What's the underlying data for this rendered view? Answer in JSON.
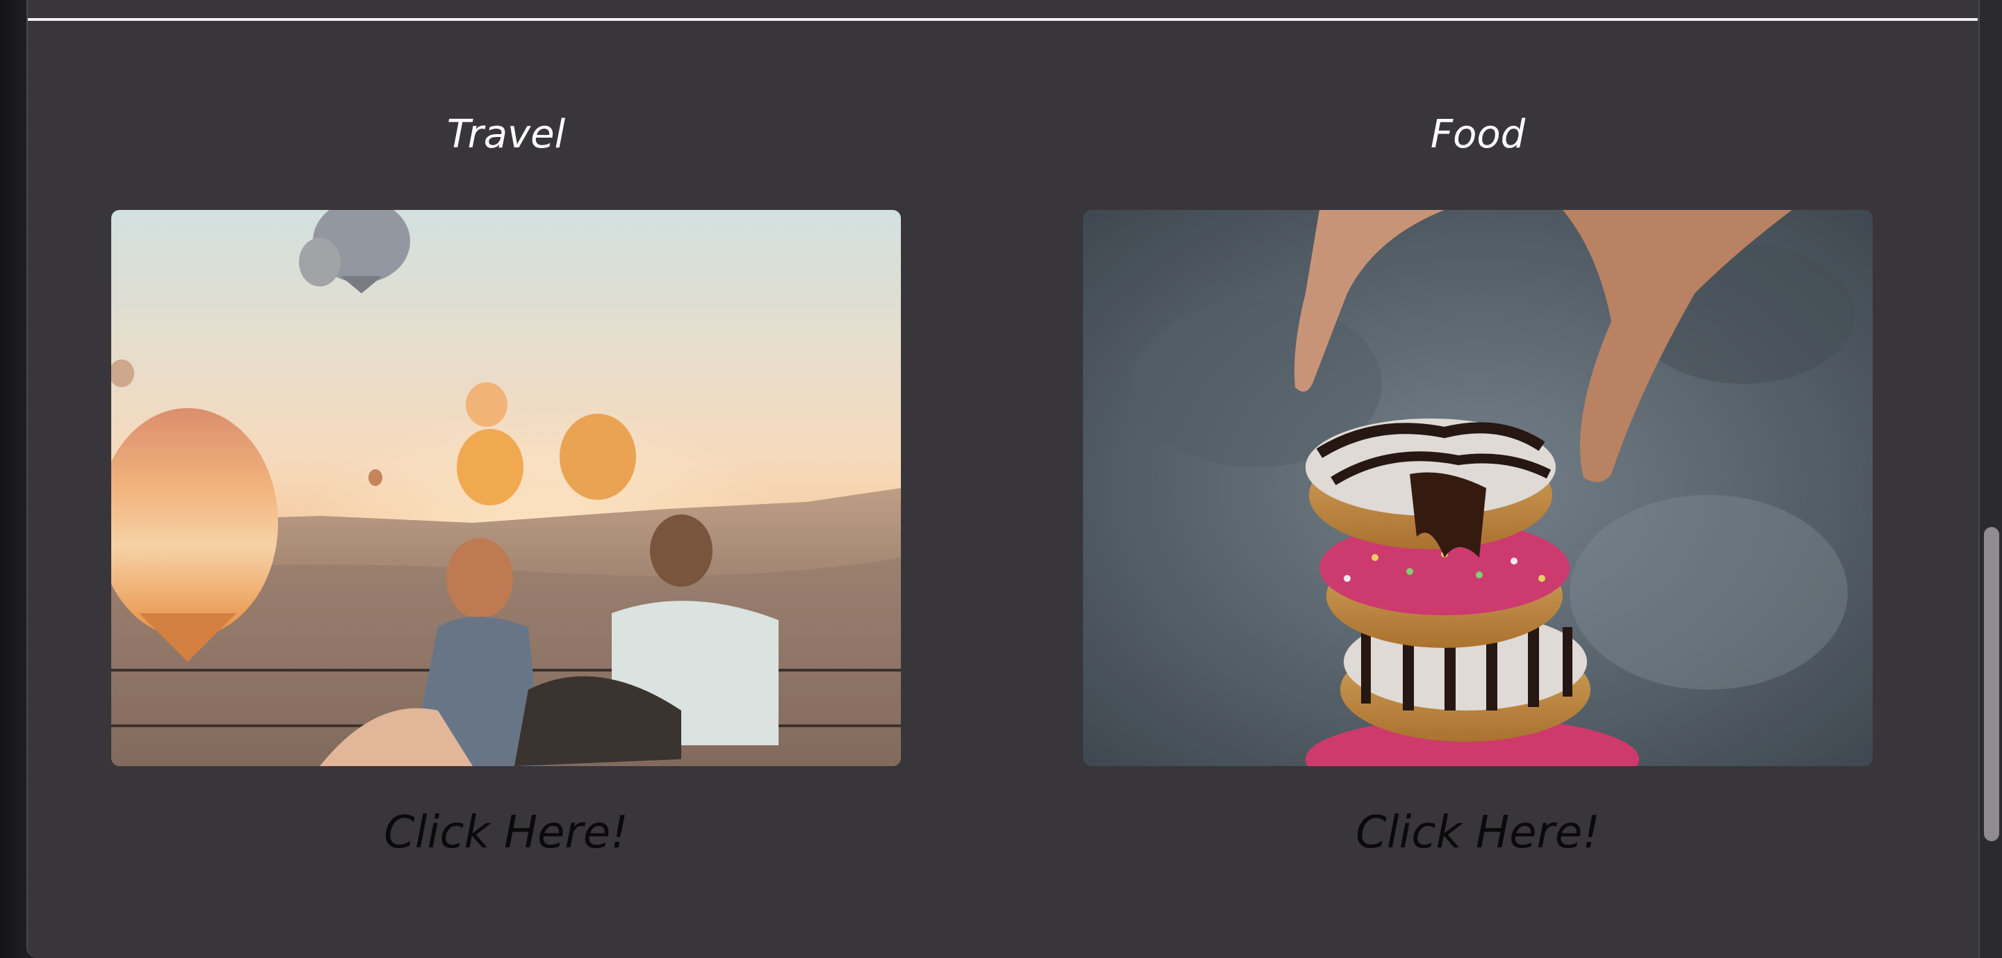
{
  "cards": [
    {
      "title": "Travel",
      "image": "hot-air-balloons-couple-sunset",
      "link_label": "Click Here!"
    },
    {
      "title": "Food",
      "image": "stacked-donuts-hand",
      "link_label": "Click Here!"
    }
  ],
  "colors": {
    "page_background": "#38363a",
    "title_text": "#ffffff",
    "link_text": "#0a0a0a",
    "rule": "#f2f2f2"
  }
}
